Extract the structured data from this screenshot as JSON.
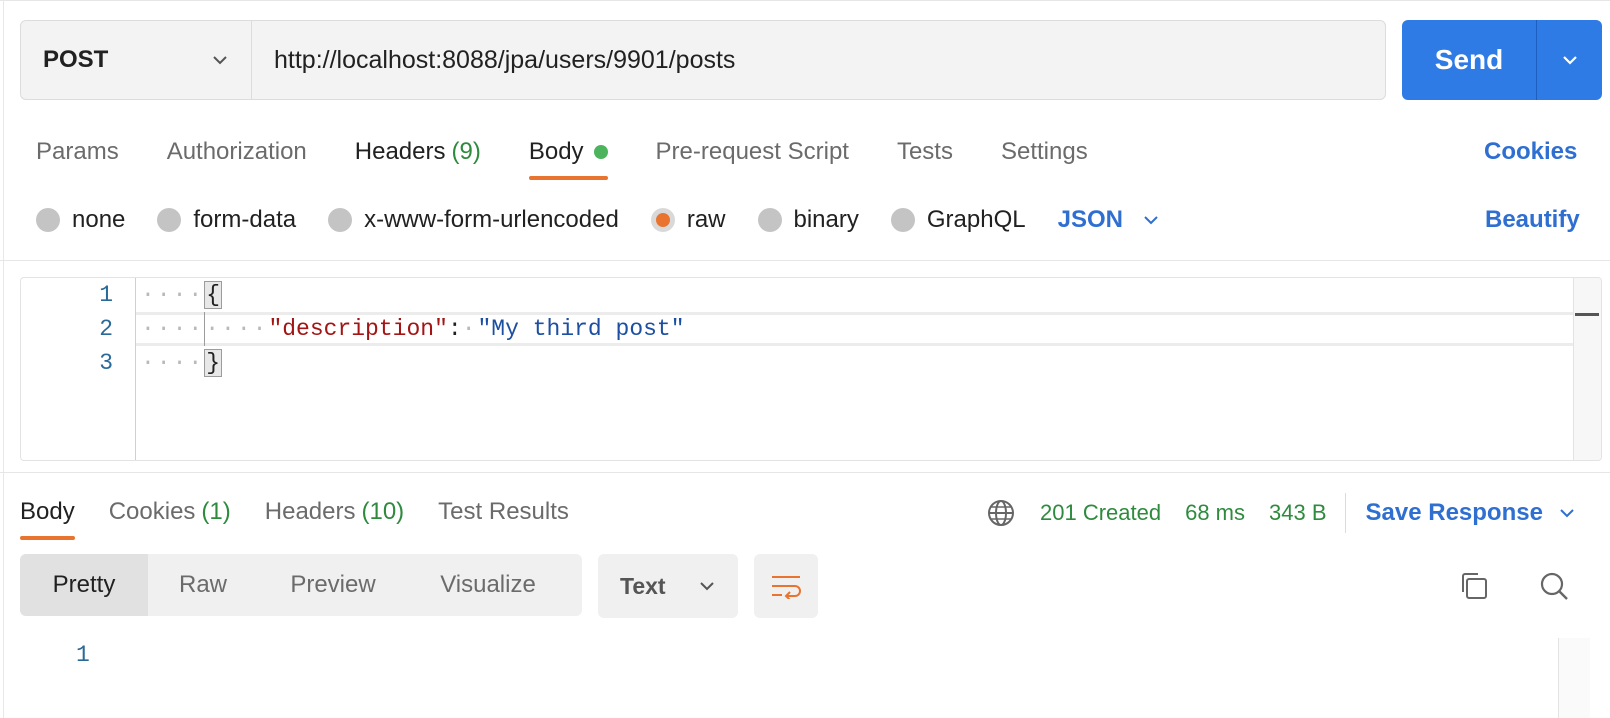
{
  "request": {
    "method": "POST",
    "url": "http://localhost:8088/jpa/users/9901/posts",
    "send_label": "Send"
  },
  "request_tabs": [
    {
      "label": "Params"
    },
    {
      "label": "Authorization"
    },
    {
      "label": "Headers",
      "count": "(9)"
    },
    {
      "label": "Body"
    },
    {
      "label": "Pre-request Script"
    },
    {
      "label": "Tests"
    },
    {
      "label": "Settings"
    }
  ],
  "cookies_label": "Cookies",
  "body_types": [
    "none",
    "form-data",
    "x-www-form-urlencoded",
    "raw",
    "binary",
    "GraphQL"
  ],
  "body_type_selected": "raw",
  "body_language": "JSON",
  "beautify_label": "Beautify",
  "editor": {
    "line_numbers": [
      "1",
      "2",
      "3"
    ],
    "open_brace": "{",
    "close_brace": "}",
    "key": "\"description\"",
    "colon": ":",
    "value": "\"My third post\""
  },
  "response_tabs": [
    {
      "label": "Body"
    },
    {
      "label": "Cookies",
      "count": "(1)"
    },
    {
      "label": "Headers",
      "count": "(10)"
    },
    {
      "label": "Test Results"
    }
  ],
  "response_status": {
    "status": "201 Created",
    "time": "68 ms",
    "size": "343 B",
    "save_label": "Save Response"
  },
  "view_modes": [
    "Pretty",
    "Raw",
    "Preview",
    "Visualize"
  ],
  "format_select": "Text",
  "response_editor": {
    "line_numbers": [
      "1"
    ]
  },
  "colors": {
    "accent_orange": "#e8742f",
    "link_blue": "#2f6fd1",
    "send_blue": "#2f7be5",
    "status_green": "#2e8b3e"
  },
  "icons": [
    "chevron-down-icon",
    "globe-icon",
    "wrap-lines-icon",
    "copy-icon",
    "search-icon"
  ]
}
